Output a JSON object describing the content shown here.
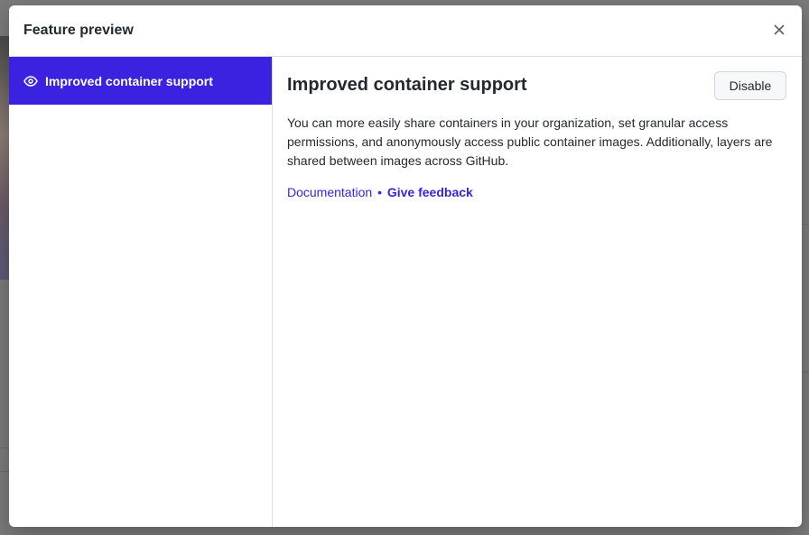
{
  "modal": {
    "title": "Feature preview",
    "close_label": "×"
  },
  "sidebar": {
    "items": [
      {
        "label": "Improved container support",
        "icon": "eye-icon",
        "selected": true
      }
    ]
  },
  "feature": {
    "title": "Improved container support",
    "disable_label": "Disable",
    "description": "You can more easily share containers in your organization, set granular access permissions, and anonymously access public container images. Additionally, layers are shared between images across GitHub.",
    "documentation_link": "Documentation",
    "separator": "•",
    "feedback_link": "Give feedback"
  },
  "colors": {
    "accent": "#3a22e0",
    "overlay": "#7a7a7a"
  }
}
